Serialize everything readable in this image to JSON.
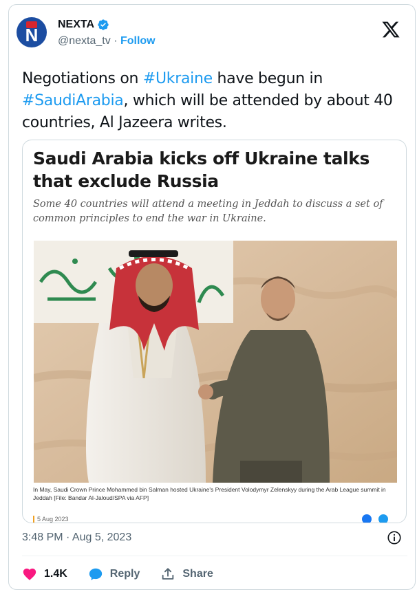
{
  "account": {
    "name": "NEXTA",
    "handle": "@nexta_tv",
    "separator": "·",
    "follow_label": "Follow",
    "avatar_letter": "N"
  },
  "tweet": {
    "text_1": "Negotiations on ",
    "tag_1": "#Ukraine",
    "text_2": " have begun in ",
    "tag_2": "#SaudiArabia",
    "text_3": ", which will be attended by about 40 countries, Al Jazeera writes."
  },
  "article": {
    "headline": "Saudi Arabia kicks off Ukraine talks that exclude Russia",
    "subhead": "Some 40 countries will attend a meeting in Jeddah to discuss a set of common principles to end the war in Ukraine.",
    "caption": "In May, Saudi Crown Prince Mohammed bin Salman hosted Ukraine's President Volodymyr Zelenskyy during the Arab League summit in Jeddah [File: Bandar Al-Jaloud/SPA via AFP]",
    "date": "5 Aug 2023"
  },
  "meta": {
    "timestamp": "3:48 PM · Aug 5, 2023"
  },
  "actions": {
    "like_count": "1.4K",
    "reply_label": "Reply",
    "share_label": "Share"
  },
  "colors": {
    "accent": "#1d9bf0",
    "like": "#f91880",
    "text": "#0f1419",
    "muted": "#536471"
  },
  "icons": [
    "verified-badge-icon",
    "x-logo-icon",
    "info-icon",
    "heart-icon",
    "reply-bubble-icon",
    "share-icon",
    "facebook-icon",
    "twitter-icon"
  ]
}
